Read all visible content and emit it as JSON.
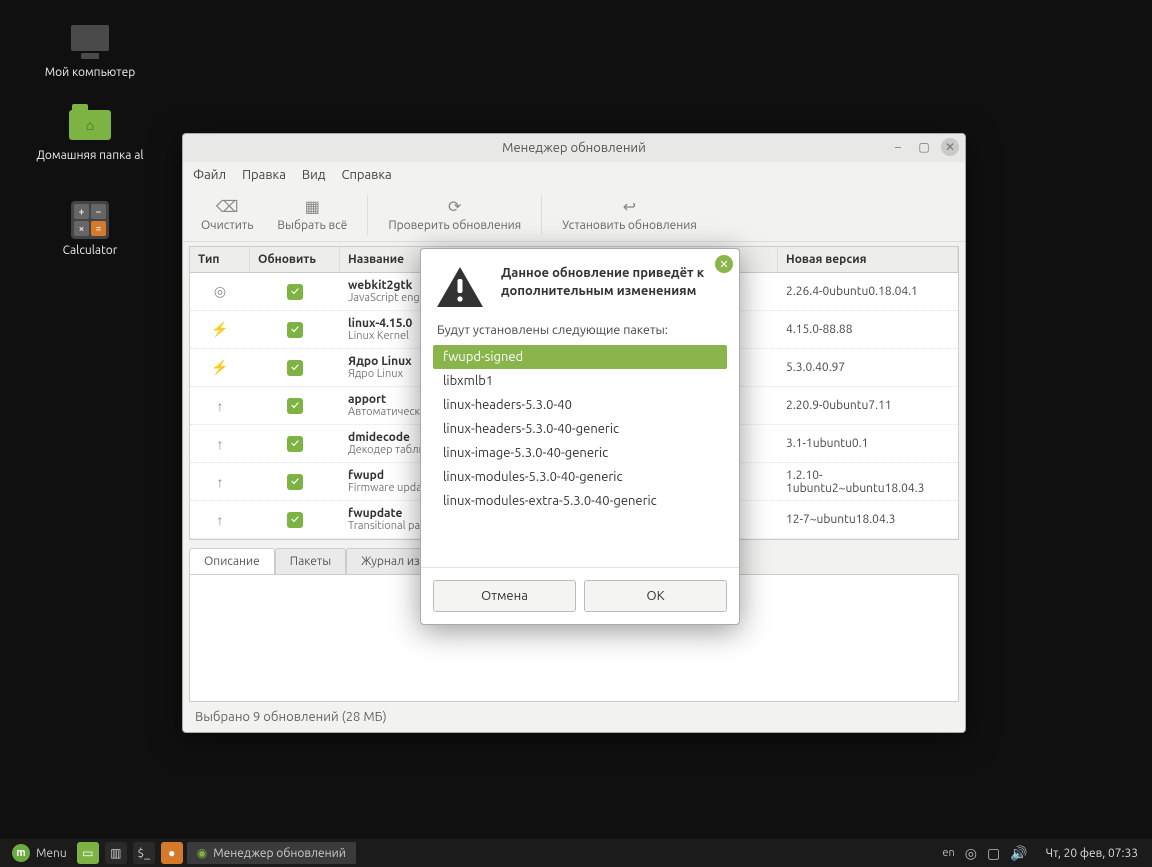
{
  "desktop": {
    "icons": [
      {
        "name": "my-computer",
        "label": "Мой компьютер"
      },
      {
        "name": "home-folder",
        "label": "Домашняя папка al"
      },
      {
        "name": "calculator",
        "label": "Calculator"
      }
    ]
  },
  "window": {
    "title": "Менеджер обновлений",
    "menu": {
      "file": "Файл",
      "edit": "Правка",
      "view": "Вид",
      "help": "Справка"
    },
    "toolbar": {
      "clear": "Очистить",
      "select_all": "Выбрать всё",
      "check": "Проверить обновления",
      "install": "Установить обновления"
    },
    "columns": {
      "type": "Тип",
      "update": "Обновить",
      "name": "Название",
      "new_version": "Новая версия"
    },
    "rows": [
      {
        "icon": "shield",
        "title": "webkit2gtk",
        "desc": "JavaScript engine library from WebKitGTK - internationalization data",
        "version": "2.26.4-0ubuntu0.18.04.1"
      },
      {
        "icon": "flash",
        "title": "linux-4.15.0",
        "desc": "Linux Kernel",
        "version": "4.15.0-88.88"
      },
      {
        "icon": "flash",
        "title": "Ядро Linux",
        "desc": "Ядро Linux",
        "version": "5.3.0.40.97"
      },
      {
        "icon": "up",
        "title": "apport",
        "desc": "Автоматическое создание отчётов об ошибках",
        "version": "2.20.9-0ubuntu7.11"
      },
      {
        "icon": "up",
        "title": "dmidecode",
        "desc": "Декодер таблиц DMI",
        "version": "3.1-1ubuntu0.1"
      },
      {
        "icon": "up",
        "title": "fwupd",
        "desc": "Firmware update daemon",
        "version": "1.2.10-1ubuntu2~ubuntu18.04.3"
      },
      {
        "icon": "up",
        "title": "fwupdate",
        "desc": "Transitional package",
        "version": "12-7~ubuntu18.04.3"
      }
    ],
    "tabs": {
      "description": "Описание",
      "packages": "Пакеты",
      "changelog": "Журнал изменений"
    },
    "status": "Выбрано 9 обновлений (28 МБ)"
  },
  "dialog": {
    "title": "Данное обновление приведёт к дополнительным изменениям",
    "subtitle": "Будут установлены следующие пакеты:",
    "items": [
      "fwupd-signed",
      "libxmlb1",
      "linux-headers-5.3.0-40",
      "linux-headers-5.3.0-40-generic",
      "linux-image-5.3.0-40-generic",
      "linux-modules-5.3.0-40-generic",
      "linux-modules-extra-5.3.0-40-generic"
    ],
    "cancel": "Отмена",
    "ok": "OK"
  },
  "panel": {
    "menu": "Menu",
    "task_title": "Менеджер обновлений",
    "lang": "en",
    "clock": "Чт, 20 фев, 07:33"
  }
}
